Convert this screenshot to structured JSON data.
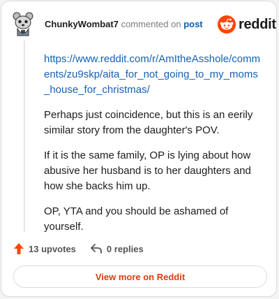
{
  "comment": {
    "username": "ChunkyWombat7",
    "verb": "commented on",
    "post_link": "post",
    "url": "https://www.reddit.com/r/AmItheAsshole/comments/zu9skp/aita_for_not_going_to_my_moms_house_for_christmas/",
    "paragraphs": [
      "Perhaps just coincidence, but this is an eerily similar story from the daughter's POV.",
      "If it is the same family, OP is lying about how abusive her husband is to her daughters and how she backs him up.",
      "OP, YTA and you should be ashamed of yourself."
    ]
  },
  "brand": {
    "name": "reddit",
    "color": "#ff4500"
  },
  "stats": {
    "upvotes": "13 upvotes",
    "replies": "0 replies"
  },
  "footer": {
    "view_more": "View more on Reddit"
  },
  "icons": {
    "avatar": "snoo-avatar-icon",
    "logo": "reddit-logo-icon",
    "upvote": "upvote-arrow-icon",
    "reply": "reply-arrow-icon"
  }
}
